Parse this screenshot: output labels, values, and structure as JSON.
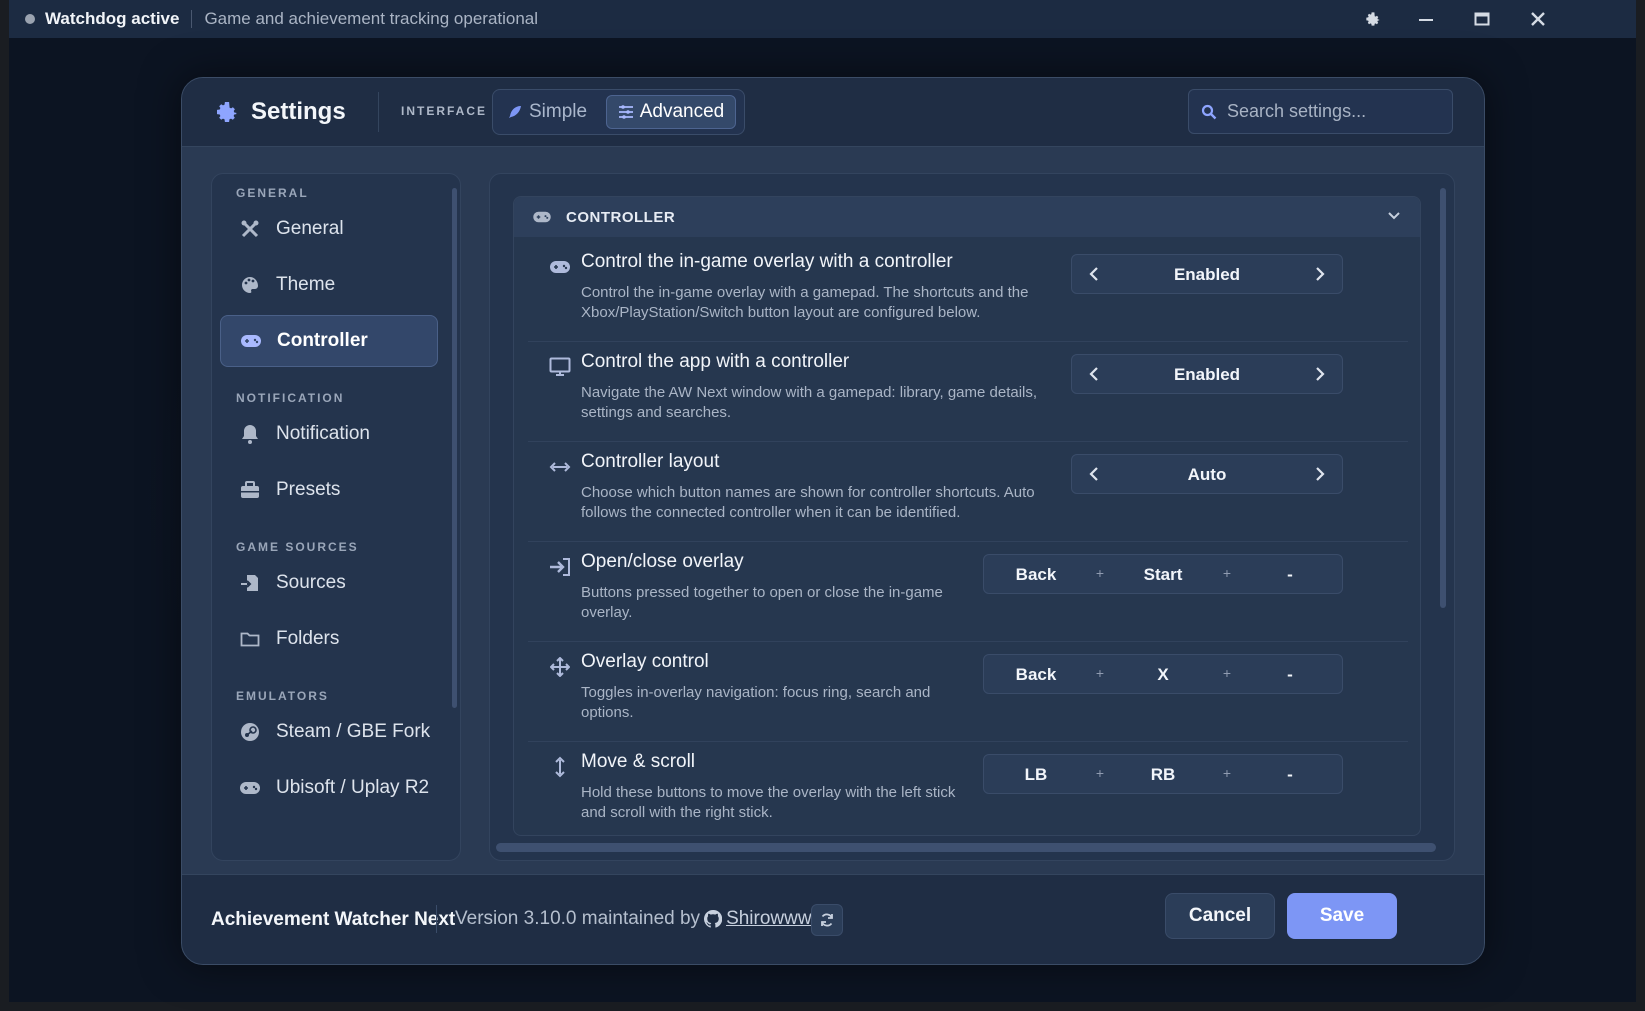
{
  "titlebar": {
    "status": "Watchdog active",
    "subtitle": "Game and achievement tracking operational"
  },
  "header": {
    "title": "Settings",
    "interface_label": "INTERFACE",
    "mode_simple": "Simple",
    "mode_advanced": "Advanced",
    "search_placeholder": "Search settings..."
  },
  "sidebar": {
    "sections": [
      "GENERAL",
      "NOTIFICATION",
      "GAME SOURCES",
      "EMULATORS"
    ],
    "items": [
      {
        "label": "General",
        "icon": "tools-icon"
      },
      {
        "label": "Theme",
        "icon": "palette-icon"
      },
      {
        "label": "Controller",
        "icon": "gamepad-icon",
        "active": true
      },
      {
        "label": "Notification",
        "icon": "bell-icon"
      },
      {
        "label": "Presets",
        "icon": "toolbox-icon"
      },
      {
        "label": "Sources",
        "icon": "import-icon"
      },
      {
        "label": "Folders",
        "icon": "folder-icon"
      },
      {
        "label": "Steam / GBE Fork",
        "icon": "steam-icon"
      },
      {
        "label": "Ubisoft / Uplay R2",
        "icon": "gamepad-icon"
      }
    ]
  },
  "section": {
    "title": "CONTROLLER",
    "rows": [
      {
        "icon": "gamepad-icon",
        "title": "Control the in-game overlay with a controller",
        "desc1": "Control the in-game overlay with a gamepad. The shortcuts and the",
        "desc2": "Xbox/PlayStation/Switch button layout are configured below.",
        "value": "Enabled"
      },
      {
        "icon": "monitor-icon",
        "title": "Control the app with a controller",
        "desc1": "Navigate the AW Next window with a gamepad: library, game details,",
        "desc2": "settings and searches.",
        "value": "Enabled"
      },
      {
        "icon": "arrows-horizontal-icon",
        "title": "Controller layout",
        "desc1": "Choose which button names are shown for controller shortcuts. Auto",
        "desc2": "follows the connected controller when it can be identified.",
        "value": "Auto"
      },
      {
        "icon": "sign-in-icon",
        "title": "Open/close overlay",
        "desc1": "Buttons pressed together to open or close the in-game",
        "desc2": "overlay.",
        "keys": [
          "Back",
          "Start",
          "-"
        ]
      },
      {
        "icon": "move-icon",
        "title": "Overlay control",
        "desc1": "Toggles in-overlay navigation: focus ring, search and",
        "desc2": "options.",
        "keys": [
          "Back",
          "X",
          "-"
        ]
      },
      {
        "icon": "arrows-vertical-icon",
        "title": "Move & scroll",
        "desc1": "Hold these buttons to move the overlay with the left stick",
        "desc2": "and scroll with the right stick.",
        "keys": [
          "LB",
          "RB",
          "-"
        ]
      }
    ],
    "plus": "+"
  },
  "footer": {
    "app_name": "Achievement Watcher Next",
    "version_text": "Version 3.10.0 maintained by",
    "author": "Shirowwww",
    "cancel": "Cancel",
    "save": "Save"
  },
  "colors": {
    "accent": "#7d96f5",
    "background": "#0c1422",
    "panel": "#24344d"
  }
}
